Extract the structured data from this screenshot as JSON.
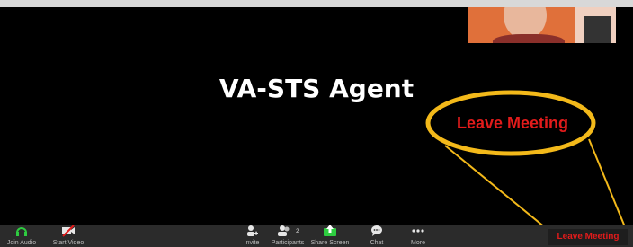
{
  "participant": {
    "name": "VA-STS Agent"
  },
  "annotation": {
    "callout_text": "Leave Meeting"
  },
  "toolbar": {
    "join_audio_label": "Join Audio",
    "start_video_label": "Start Video",
    "invite_label": "Invite",
    "participants_label": "Participants",
    "participants_count": "2",
    "share_screen_label": "Share Screen",
    "chat_label": "Chat",
    "more_label": "More",
    "leave_label": "Leave Meeting"
  },
  "colors": {
    "accent_red": "#e21b1b",
    "callout_yellow": "#f3b91a",
    "share_green": "#2ecc40",
    "audio_green": "#2ecc40"
  }
}
